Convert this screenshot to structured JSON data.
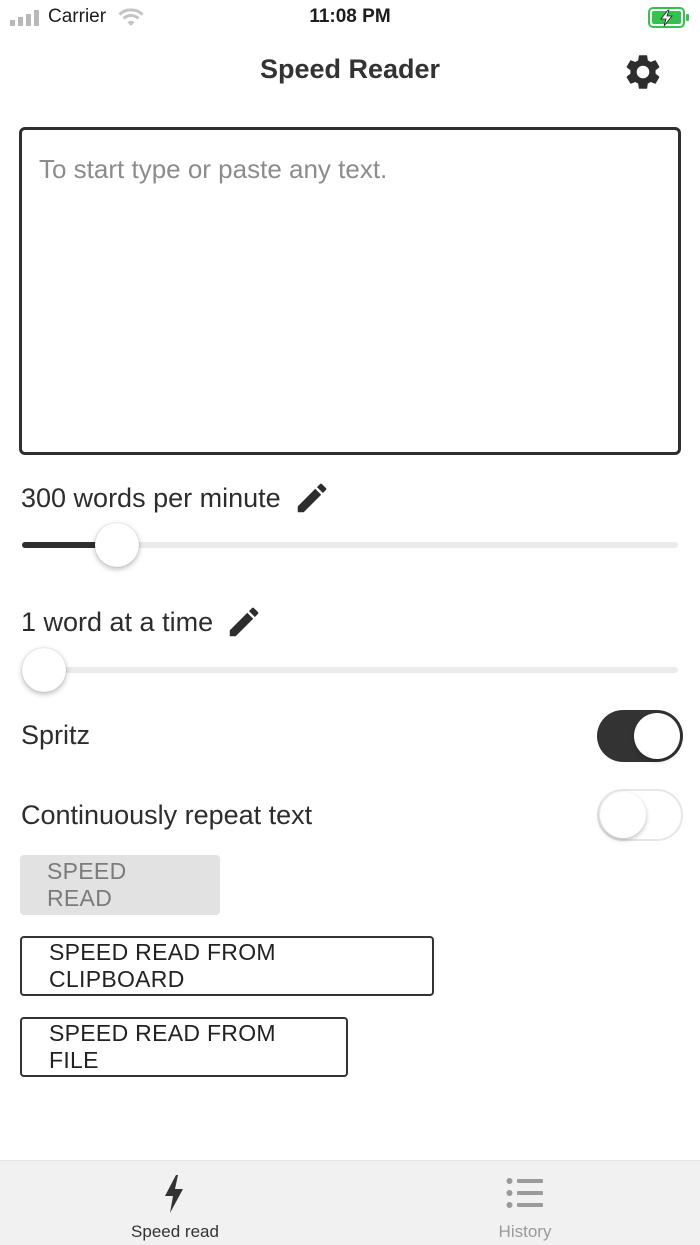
{
  "status_bar": {
    "carrier": "Carrier",
    "time": "11:08 PM"
  },
  "header": {
    "title": "Speed Reader",
    "settings_icon": "gear-icon"
  },
  "input": {
    "placeholder": "To start type or paste any text.",
    "value": ""
  },
  "wpm": {
    "label": "300 words per minute",
    "edit_icon": "pencil-icon",
    "slider_fraction": 0.12
  },
  "chunk": {
    "label": "1 word at a time",
    "edit_icon": "pencil-icon",
    "slider_fraction": 0.0
  },
  "toggles": {
    "spritz": {
      "label": "Spritz",
      "on": true
    },
    "repeat": {
      "label": "Continuously repeat text",
      "on": false
    }
  },
  "buttons": {
    "speed_read": "SPEED READ",
    "from_clipboard": "SPEED READ FROM CLIPBOARD",
    "from_file": "SPEED READ FROM FILE"
  },
  "tabs": [
    {
      "label": "Speed read",
      "icon": "lightning-icon",
      "active": true
    },
    {
      "label": "History",
      "icon": "list-icon",
      "active": false
    }
  ],
  "colors": {
    "accent": "#333333",
    "inactive_tab": "#9a9a9a",
    "tabbar_bg": "#f1f1f1",
    "battery": "#33c24d"
  }
}
